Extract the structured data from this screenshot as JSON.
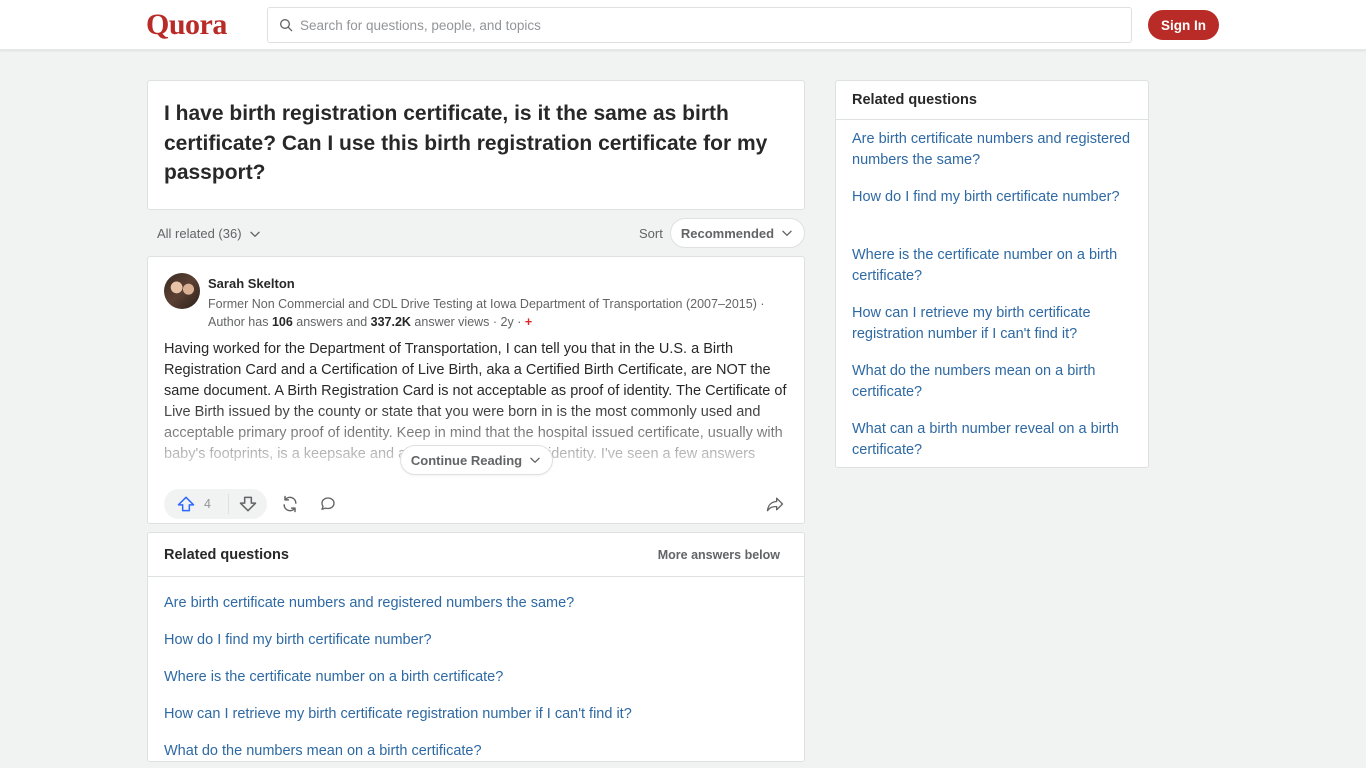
{
  "header": {
    "logo": "Quora",
    "search_placeholder": "Search for questions, people, and topics",
    "sign_in": "Sign In"
  },
  "question": {
    "title": "I have birth registration certificate, is it the same as birth certificate? Can I use this birth registration certificate for my passport?"
  },
  "filters": {
    "all_related": "All related (36)",
    "sort_label": "Sort",
    "sort_value": "Recommended"
  },
  "answer": {
    "author": "Sarah Skelton",
    "credential": "Former Non Commercial and CDL Drive Testing at Iowa Department of Transportation (2007–2015) ·",
    "stats_prefix": "Author has ",
    "answers_count": "106",
    "stats_middle": " answers and ",
    "views_count": "337.2K",
    "stats_suffix": " answer views · 2y ·",
    "body": "Having worked for the Department of Transportation, I can tell you that in the U.S. a Birth Registration Card and a Certification of Live Birth, aka a Certified Birth Certificate, are NOT the same document. A Birth Registration Card is not acceptable as proof of identity. The Certificate of Live Birth issued by the county or state that you were born in is the most commonly used and acceptable primary proof of identity. Keep in mind that the hospital issued certificate, usually with baby's footprints, is a keepsake and also not a valid form of identity. I've seen a few answers stating that",
    "continue_reading": "Continue Reading",
    "upvotes": "4"
  },
  "related_main": {
    "title": "Related questions",
    "more": "More answers below",
    "items": [
      "Are birth certificate numbers and registered numbers the same?",
      "How do I find my birth certificate number?",
      "Where is the certificate number on a birth certificate?",
      "How can I retrieve my birth certificate registration number if I can't find it?",
      "What do the numbers mean on a birth certificate?"
    ]
  },
  "sidebar": {
    "title": "Related questions",
    "items": [
      "Are birth certificate numbers and registered numbers the same?",
      "How do I find my birth certificate number?",
      "Where is the certificate number on a birth certificate?",
      "How can I retrieve my birth certificate registration number if I can't find it?",
      "What do the numbers mean on a birth certificate?",
      "What can a birth number reveal on a birth certificate?"
    ]
  },
  "colors": {
    "brand": "#b92b27",
    "link": "#2e69a3",
    "upvote": "#2e69ff"
  }
}
